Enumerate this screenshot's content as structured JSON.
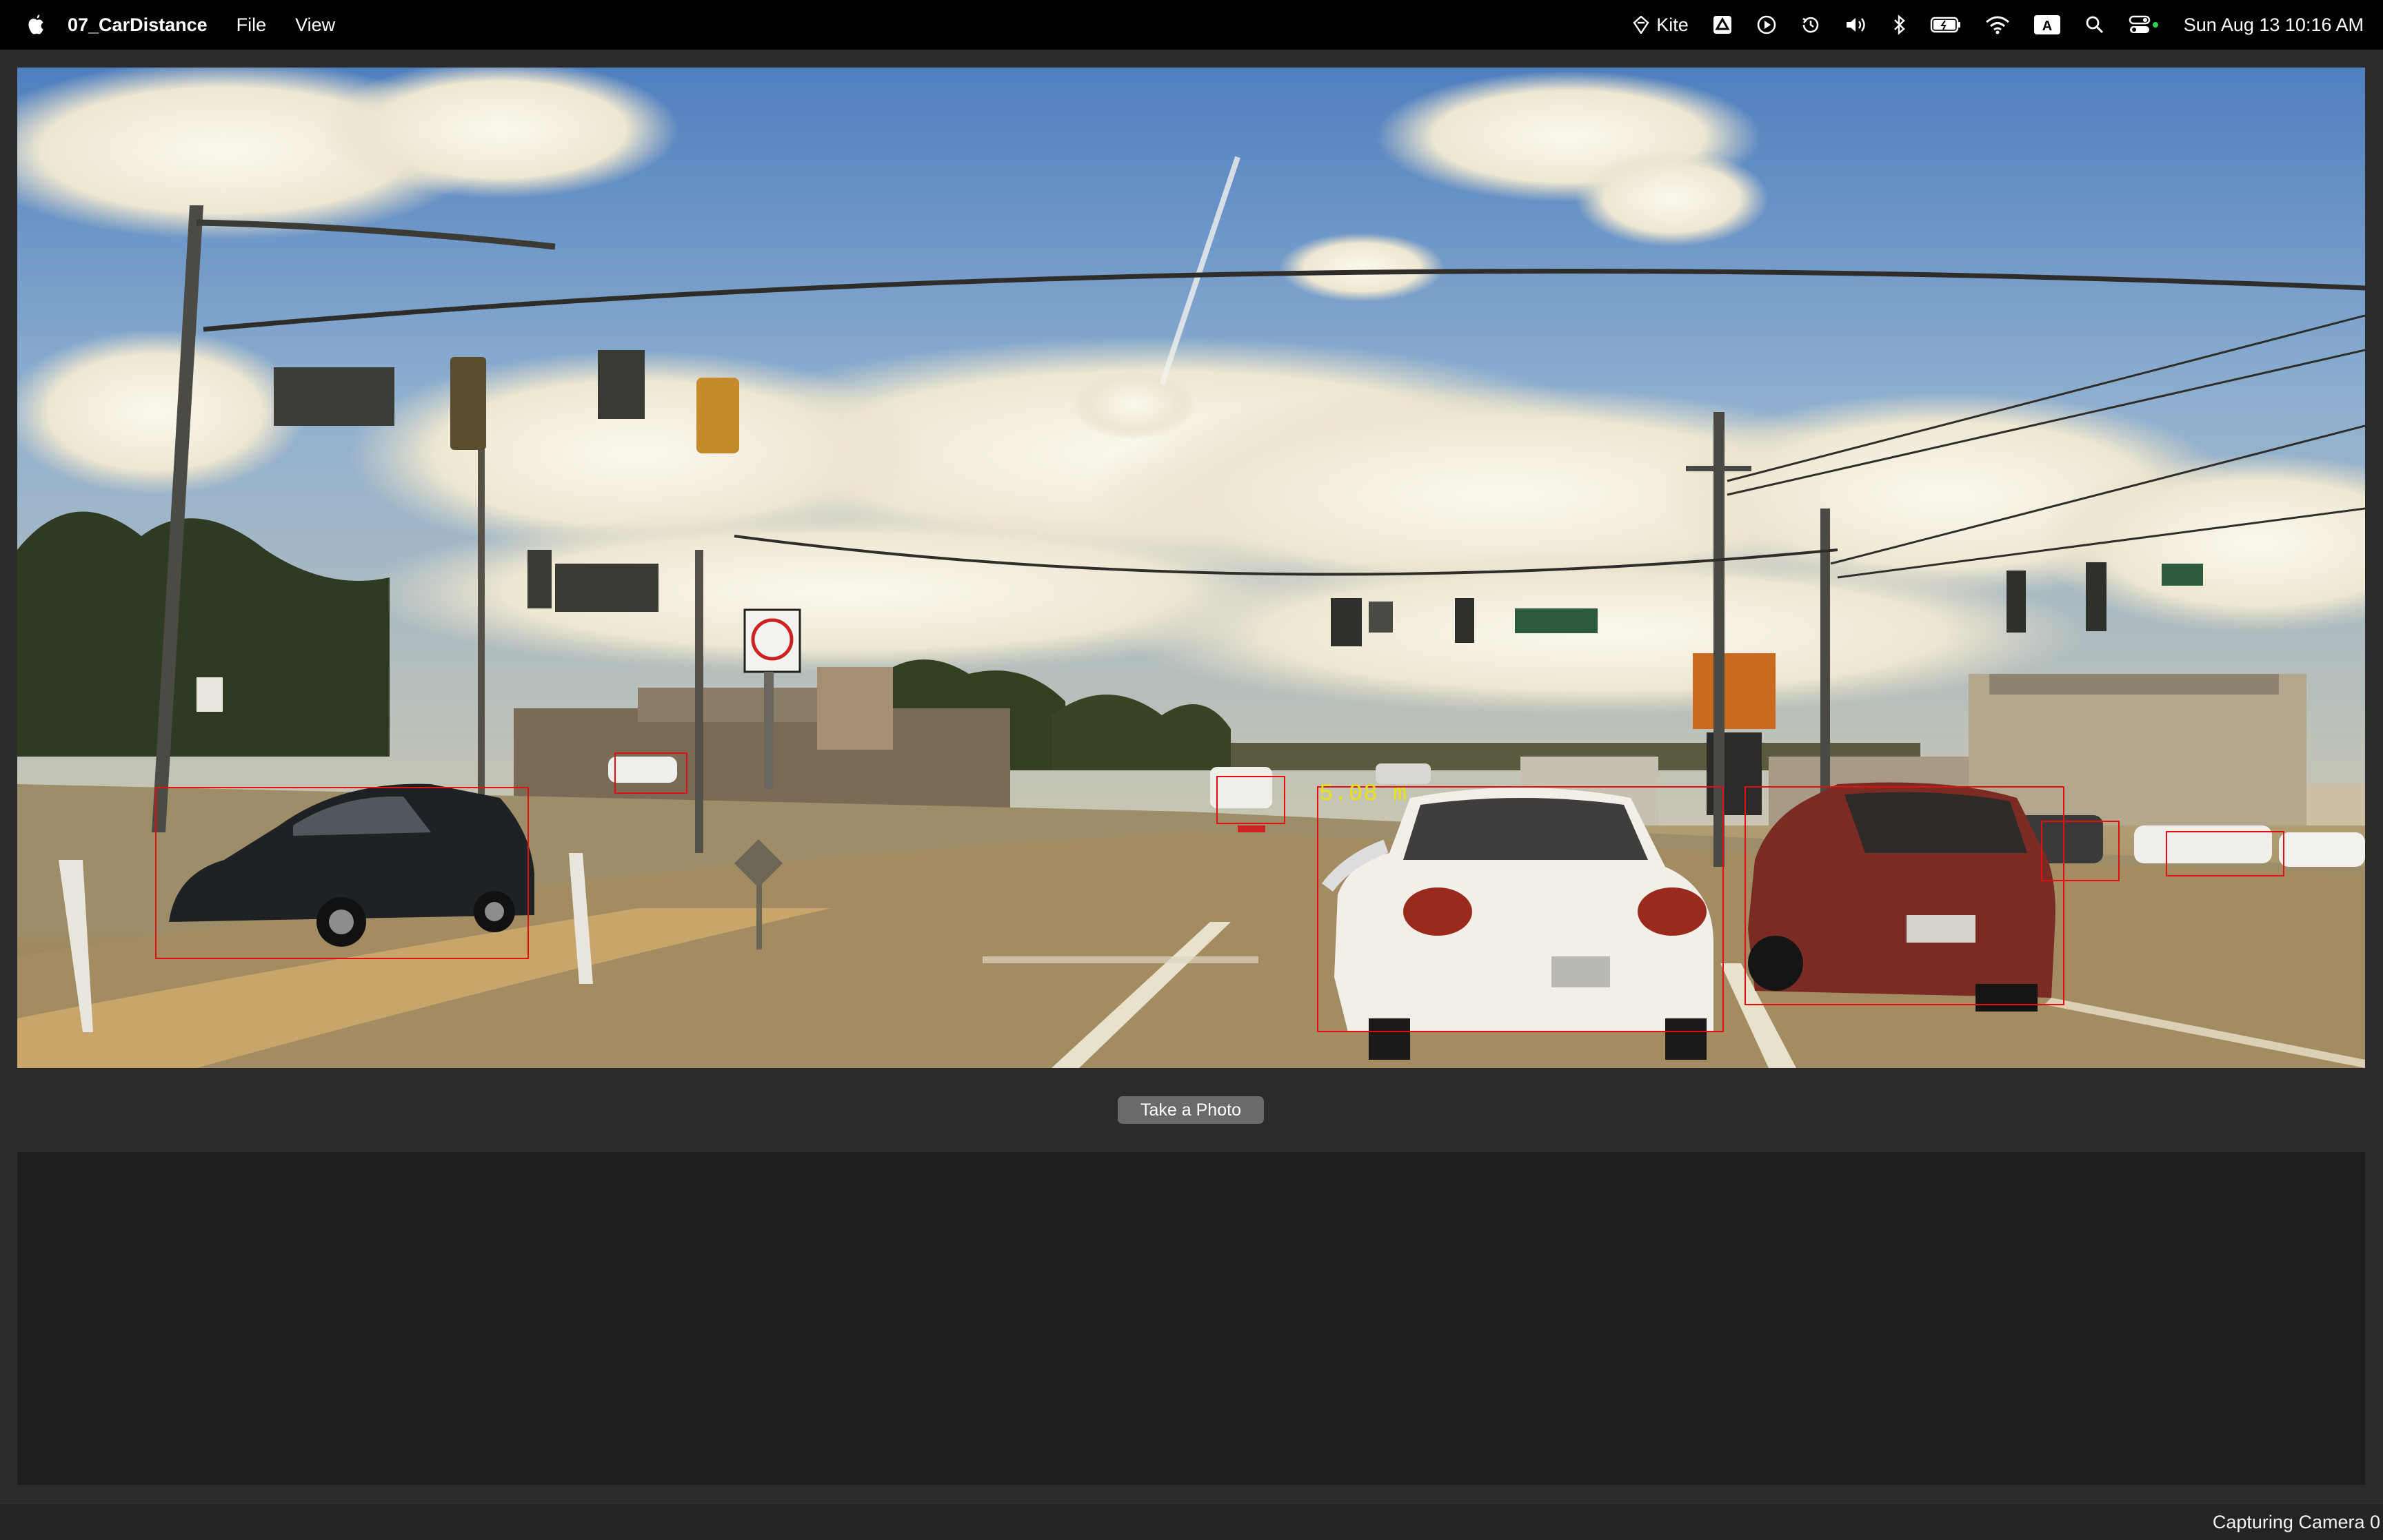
{
  "menubar": {
    "app_name": "07_CarDistance",
    "menus": [
      "File",
      "View"
    ],
    "status_items": {
      "kite_label": "Kite",
      "clock": "Sun Aug 13  10:16 AM"
    },
    "icons": [
      "apple-icon",
      "kite-icon",
      "drive-icon",
      "play-icon",
      "time-machine-icon",
      "volume-icon",
      "bluetooth-icon",
      "battery-icon",
      "wifi-icon",
      "input-source-icon",
      "spotlight-icon",
      "control-center-icon"
    ]
  },
  "camera": {
    "distance_label": "5.08 m",
    "box_color": "#e01010",
    "label_color": "#e9e214"
  },
  "controls": {
    "take_photo_label": "Take a Photo"
  },
  "status": {
    "text": "Capturing Camera 0"
  }
}
